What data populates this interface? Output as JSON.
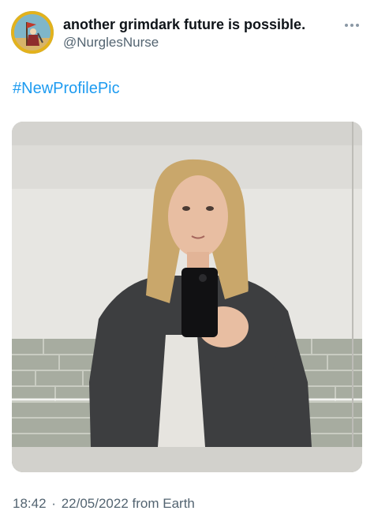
{
  "tweet": {
    "author": {
      "display_name": "another grimdark future is possible.",
      "handle": "@NurglesNurse"
    },
    "more_icon": "more-horizontal-icon",
    "text": {
      "hashtag": "#NewProfilePic"
    },
    "media": {
      "kind": "photo",
      "description_icon": "mirror-selfie-photo"
    },
    "meta": {
      "time": "18:42",
      "separator": "·",
      "date": "22/05/2022",
      "source": "from Earth"
    }
  },
  "colors": {
    "text_primary": "#0f1419",
    "text_secondary": "#536471",
    "link": "#1d9bf0",
    "background": "#ffffff"
  }
}
